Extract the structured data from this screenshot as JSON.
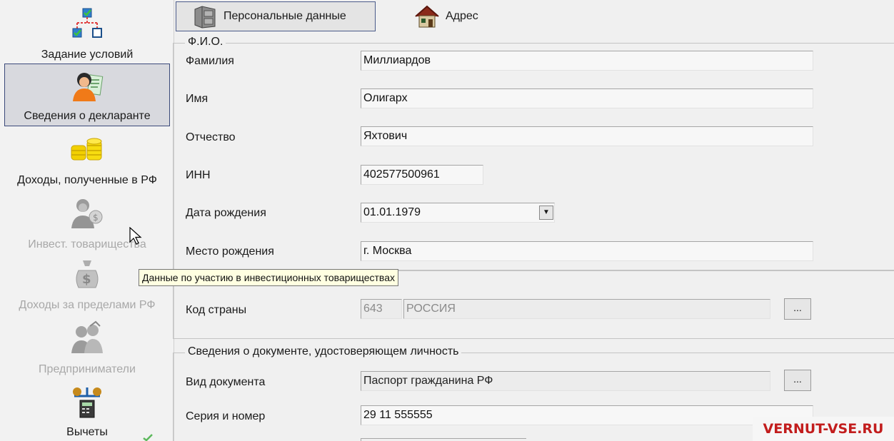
{
  "sidebar": {
    "items": [
      {
        "label": "Задание условий",
        "icon": "conditions-tree-icon",
        "state": "normal"
      },
      {
        "label": "Сведения о декларанте",
        "icon": "declarant-person-icon",
        "state": "selected"
      },
      {
        "label": "Доходы, полученные в РФ",
        "icon": "coins-icon",
        "state": "normal"
      },
      {
        "label": "Инвест. товарищества",
        "icon": "investor-person-icon",
        "state": "disabled"
      },
      {
        "label": "Доходы за пределами РФ",
        "icon": "money-bag-icon",
        "state": "disabled"
      },
      {
        "label": "Предприниматели",
        "icon": "entrepreneur-icon",
        "state": "disabled"
      },
      {
        "label": "Вычеты",
        "icon": "deductions-calculator-icon",
        "state": "normal"
      }
    ]
  },
  "tabs": [
    {
      "label": "Персональные данные",
      "icon": "cabinet-icon",
      "active": true
    },
    {
      "label": "Адрес",
      "icon": "house-icon",
      "active": false
    }
  ],
  "fio_group": {
    "legend": "Ф.И.О.",
    "surname_label": "Фамилия",
    "surname_value": "Миллиардов",
    "name_label": "Имя",
    "name_value": "Олигарх",
    "patronymic_label": "Отчество",
    "patronymic_value": "Яхтович",
    "inn_label": "ИНН",
    "inn_value": "402577500961",
    "birthdate_label": "Дата рождения",
    "birthdate_value": "01.01.1979",
    "birthplace_label": "Место рождения",
    "birthplace_value": "г. Москва"
  },
  "country": {
    "label": "Код страны",
    "code": "643",
    "name": "РОССИЯ",
    "button": "..."
  },
  "document_group": {
    "legend": "Сведения о документе, удостоверяющем личность",
    "type_label": "Вид документа",
    "type_value": "Паспорт гражданина РФ",
    "type_button": "...",
    "series_label": "Серия и номер",
    "series_value": "29 11 555555"
  },
  "tooltip": "Данные по участию в инвестиционных товариществах",
  "watermark": "VERNUT-VSE.RU",
  "colors": {
    "selection_border": "#3b4a7a",
    "tooltip_bg": "#ffffe1",
    "watermark": "#c21d1d"
  }
}
